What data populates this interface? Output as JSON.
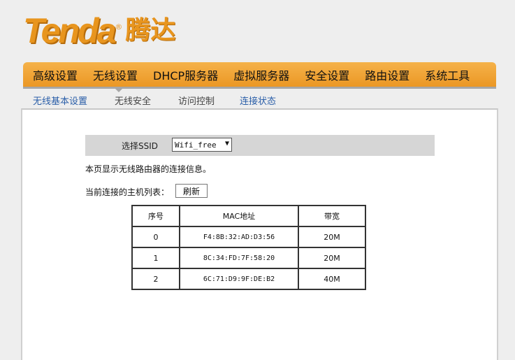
{
  "logo": {
    "brand": "Tenda",
    "chinese": "腾达",
    "reg": "®"
  },
  "main_nav": [
    "高级设置",
    "无线设置",
    "DHCP服务器",
    "虚拟服务器",
    "安全设置",
    "路由设置",
    "系统工具"
  ],
  "sub_nav": [
    {
      "label": "无线基本设置",
      "active": false
    },
    {
      "label": "无线安全",
      "active": true
    },
    {
      "label": "访问控制",
      "active": false
    },
    {
      "label": "连接状态",
      "active": false
    }
  ],
  "ssid": {
    "label": "选择SSID",
    "selected": "Wifi_free"
  },
  "info_text": "本页显示无线路由器的连接信息。",
  "host_list": {
    "label": "当前连接的主机列表：",
    "refresh_label": "刷新",
    "columns": [
      "序号",
      "MAC地址",
      "带宽"
    ],
    "rows": [
      [
        "0",
        "F4:8B:32:AD:D3:56",
        "20M"
      ],
      [
        "1",
        "8C:34:FD:7F:58:20",
        "20M"
      ],
      [
        "2",
        "6C:71:D9:9F:DE:B2",
        "40M"
      ]
    ]
  },
  "colors": {
    "accent": "#eb9724",
    "link": "#2a5ea8"
  }
}
